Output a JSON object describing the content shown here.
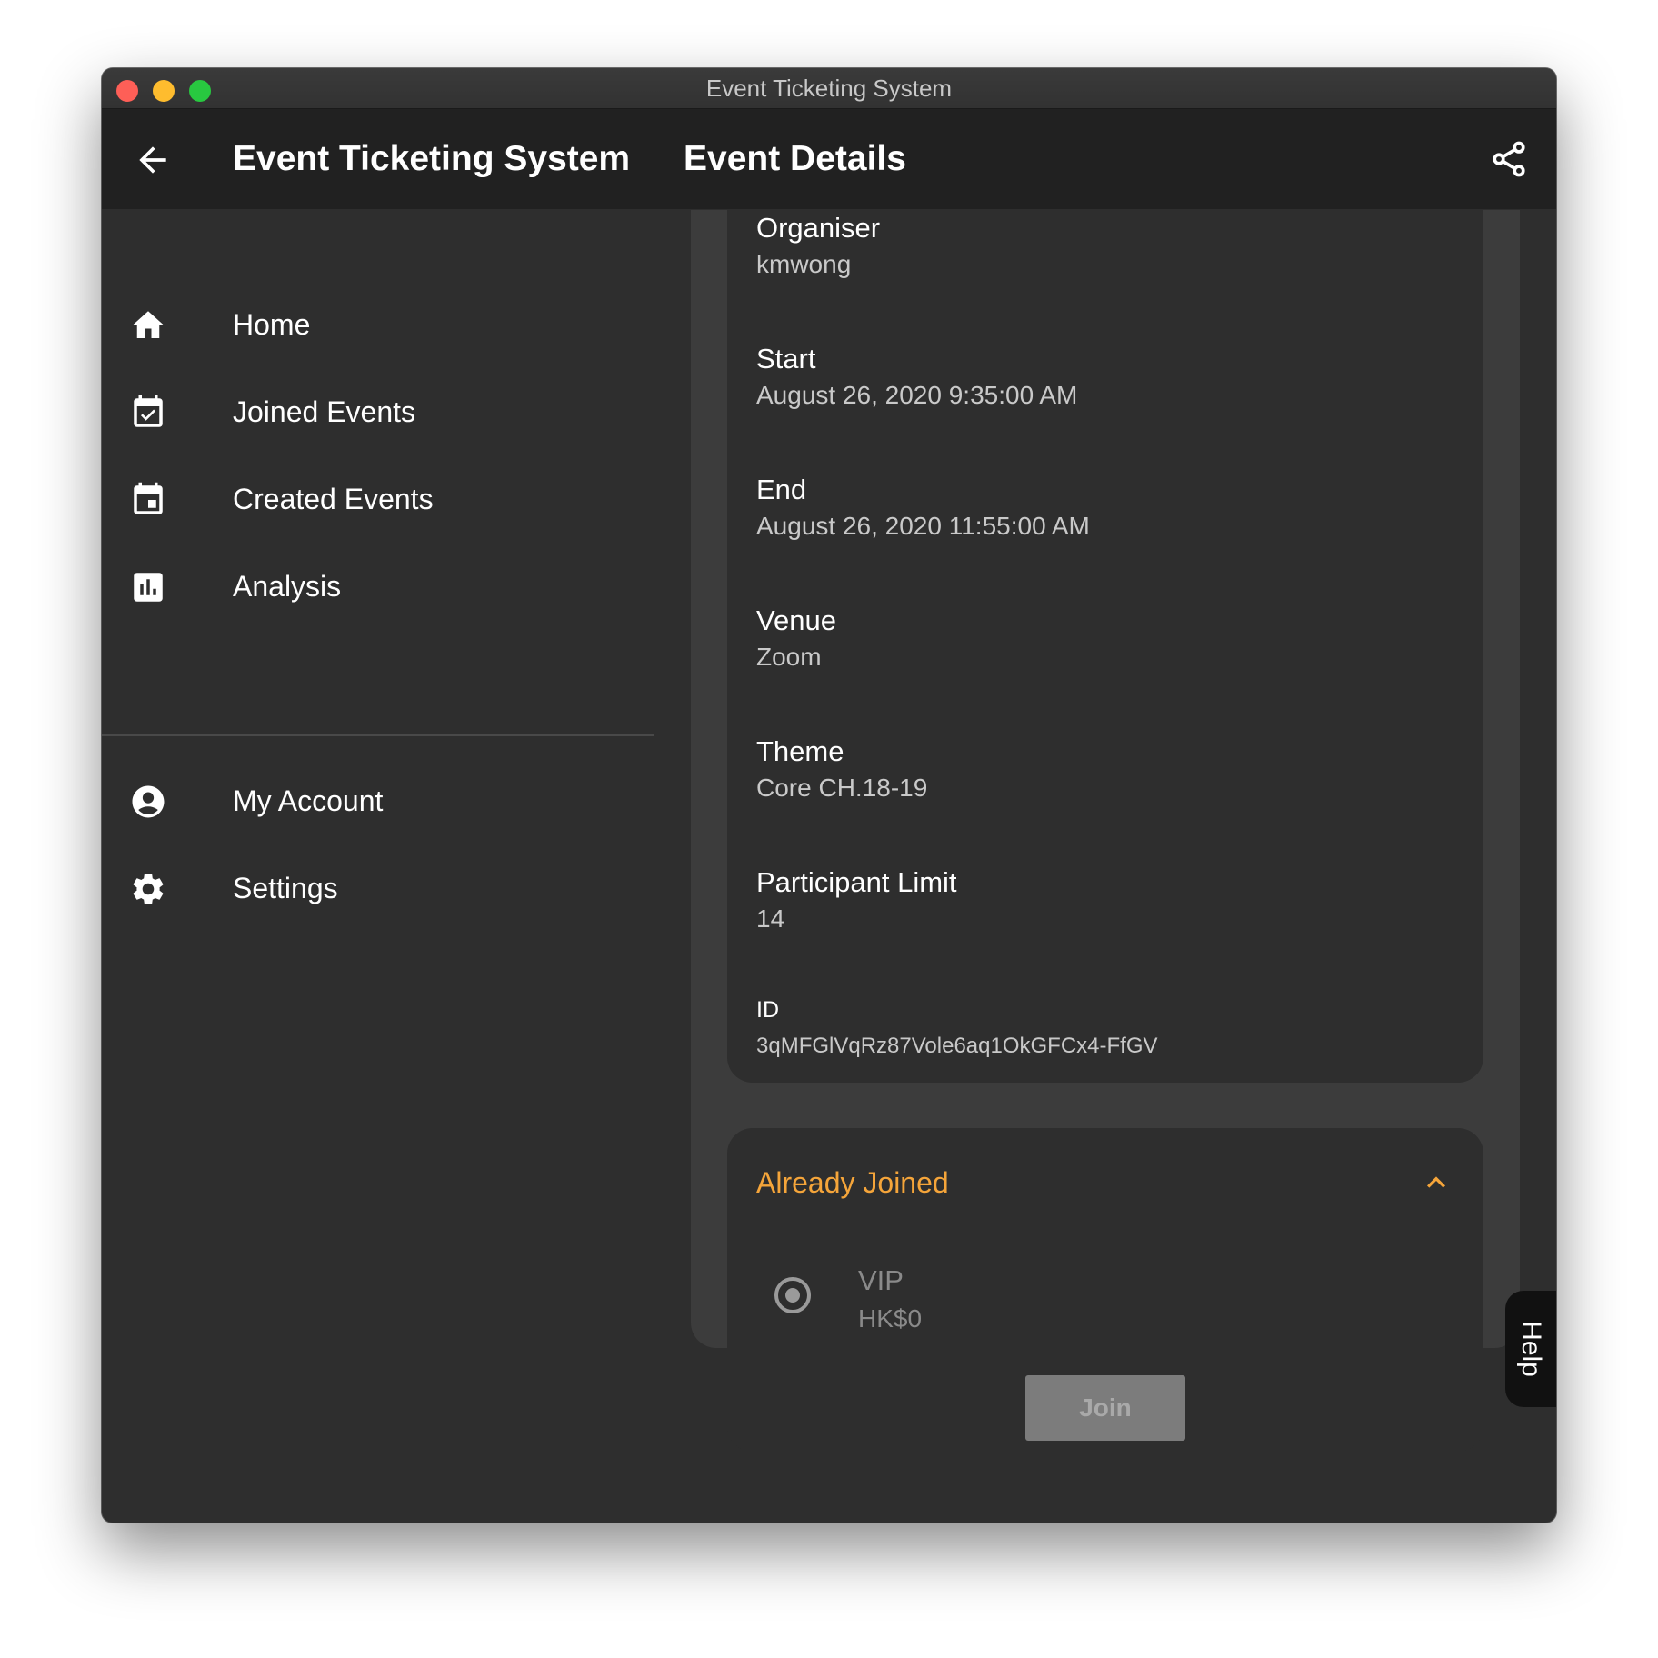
{
  "window": {
    "title": "Event Ticketing System"
  },
  "appbar": {
    "app_name": "Event Ticketing System",
    "page_title": "Event Details"
  },
  "sidebar": {
    "items": [
      {
        "label": "Home",
        "icon": "home-icon"
      },
      {
        "label": "Joined Events",
        "icon": "event-available-icon"
      },
      {
        "label": "Created Events",
        "icon": "event-icon"
      },
      {
        "label": "Analysis",
        "icon": "bar-chart-icon"
      },
      {
        "label": "My Account",
        "icon": "account-circle-icon"
      },
      {
        "label": "Settings",
        "icon": "gear-icon"
      }
    ]
  },
  "details": {
    "organiser": {
      "label": "Organiser",
      "value": "kmwong"
    },
    "start": {
      "label": "Start",
      "value": "August 26, 2020 9:35:00 AM"
    },
    "end": {
      "label": "End",
      "value": "August 26, 2020 11:55:00 AM"
    },
    "venue": {
      "label": "Venue",
      "value": "Zoom"
    },
    "theme": {
      "label": "Theme",
      "value": "Core CH.18-19"
    },
    "limit": {
      "label": "Participant Limit",
      "value": "14"
    },
    "id": {
      "label": "ID",
      "value": "3qMFGlVqRz87Vole6aq1OkGFCx4-FfGV"
    }
  },
  "joined": {
    "title": "Already Joined",
    "ticket": {
      "name": "VIP",
      "price": "HK$0",
      "selected": true
    },
    "join_label": "Join"
  },
  "help": {
    "label": "Help"
  },
  "colors": {
    "accent": "#f5a53a",
    "appbar": "#212121",
    "background": "#2e2e2e",
    "panel": "#3c3c3c"
  }
}
